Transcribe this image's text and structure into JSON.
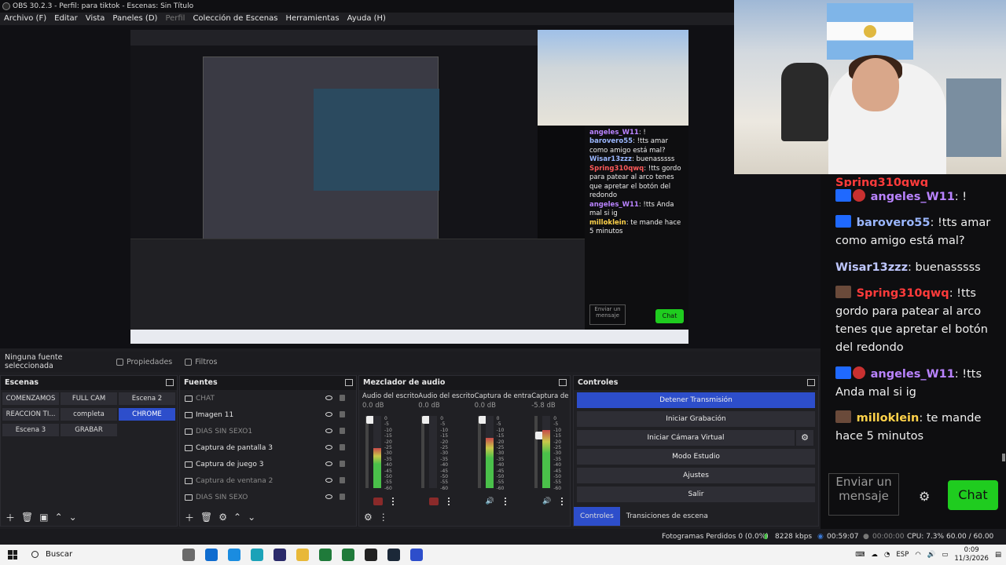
{
  "titlebar": {
    "title": "OBS 30.2.3 - Perfil: para tiktok - Escenas: Sin Título"
  },
  "menu": [
    {
      "label": "Archivo (F)",
      "disabled": false
    },
    {
      "label": "Editar",
      "disabled": false
    },
    {
      "label": "Vista",
      "disabled": false
    },
    {
      "label": "Paneles (D)",
      "disabled": false
    },
    {
      "label": "Perfil",
      "disabled": true
    },
    {
      "label": "Colección de Escenas",
      "disabled": false
    },
    {
      "label": "Herramientas",
      "disabled": false
    },
    {
      "label": "Ayuda (H)",
      "disabled": false
    }
  ],
  "preview": {
    "mini_chat": [
      {
        "name": "angeles_W11",
        "text": ": !"
      },
      {
        "name": "barovero55",
        "text": ": !tts amar como amigo está mal?"
      },
      {
        "name": "Wisar13zzz",
        "text": ": buenasssss"
      },
      {
        "name": "Spring310qwq",
        "text": ": !tts gordo para patear al arco tenes que apretar el botón del redondo"
      },
      {
        "name": "angeles_W11",
        "text": ": !tts Anda mal si ig"
      },
      {
        "name": "milloklein",
        "text": ": te mande hace 5 minutos"
      }
    ],
    "mini_send": "Enviar un mensaje",
    "mini_chat_btn": "Chat"
  },
  "source_bar": {
    "no_source": "Ninguna fuente seleccionada",
    "properties": "Propiedades",
    "filters": "Filtros"
  },
  "scenes": {
    "title": "Escenas",
    "items": [
      {
        "label": "COMENZAMOS",
        "active": false
      },
      {
        "label": "FULL CAM",
        "active": false
      },
      {
        "label": "Escena 2",
        "active": false
      },
      {
        "label": "REACCION TI...",
        "active": false
      },
      {
        "label": "completa",
        "active": false
      },
      {
        "label": "CHROME",
        "active": true
      },
      {
        "label": "Escena 3",
        "active": false
      },
      {
        "label": "GRABAR",
        "active": false
      }
    ]
  },
  "sources": {
    "title": "Fuentes",
    "items": [
      {
        "label": "CHAT",
        "visible": false
      },
      {
        "label": "Imagen 11",
        "visible": true
      },
      {
        "label": "DIAS SIN SEXO1",
        "visible": false
      },
      {
        "label": "Captura de pantalla 3",
        "visible": true
      },
      {
        "label": "Captura de juego 3",
        "visible": true
      },
      {
        "label": "Captura de ventana 2",
        "visible": false
      },
      {
        "label": "DIAS SIN SEXO",
        "visible": false
      }
    ]
  },
  "mixer": {
    "title": "Mezclador de audio",
    "channels": [
      {
        "name": "Audio del escrito",
        "db": "0.0 dB",
        "level": 0.55,
        "muted": true
      },
      {
        "name": "Audio del escrito",
        "db": "0.0 dB",
        "level": 0.0,
        "muted": true
      },
      {
        "name": "Captura de entra",
        "db": "0.0 dB",
        "level": 0.7,
        "muted": false
      },
      {
        "name": "Captura de",
        "db": "-5.8 dB",
        "level": 0.8,
        "muted": false
      }
    ],
    "scale": [
      "0",
      "-5",
      "-10",
      "-15",
      "-20",
      "-25",
      "-30",
      "-35",
      "-40",
      "-45",
      "-50",
      "-55",
      "-60"
    ]
  },
  "controls": {
    "title": "Controles",
    "stop_stream": "Detener Transmisión",
    "start_record": "Iniciar Grabación",
    "start_vcam": "Iniciar Cámara Virtual",
    "studio_mode": "Modo Estudio",
    "settings": "Ajustes",
    "exit": "Salir",
    "tab_controls": "Controles",
    "tab_transitions": "Transiciones de escena"
  },
  "status": {
    "dropped": "Fotogramas Perdidos 0 (0.0%)",
    "bitrate": "8228 kbps",
    "stream_time": "00:59:07",
    "record_time": "00:00:00",
    "cpu": "CPU: 7.3%",
    "fps": "60.00 / 60.00 FPS"
  },
  "chat": {
    "partial": "Spring310qwq",
    "messages": [
      {
        "badge": "blue",
        "name": "angeles_W11",
        "color": "purple",
        "text": ": !"
      },
      {
        "badge": "blue",
        "name": "barovero55",
        "color": "blue",
        "text": ": !tts amar como amigo está mal?"
      },
      {
        "badge": "none",
        "name": "Wisar13zzz",
        "color": "white",
        "text": ": buenasssss"
      },
      {
        "badge": "face",
        "name": "Spring310qwq",
        "color": "red",
        "text": ": !tts gordo para patear al arco tenes que apretar el botón del redondo"
      },
      {
        "badge": "blue",
        "name": "angeles_W11",
        "color": "purple",
        "text": ": !tts Anda mal si ig"
      },
      {
        "badge": "face",
        "name": "milloklein",
        "color": "yellow",
        "text": ": te mande hace 5 minutos"
      }
    ],
    "send_placeholder": "Enviar un mensaje",
    "chat_button": "Chat"
  },
  "taskbar": {
    "search": "Buscar",
    "lang": "ESP",
    "time": "0:09",
    "date": "11/3/2026"
  },
  "colors": {
    "accent": "#2d4ecb",
    "chat_green": "#1fcc1f"
  }
}
